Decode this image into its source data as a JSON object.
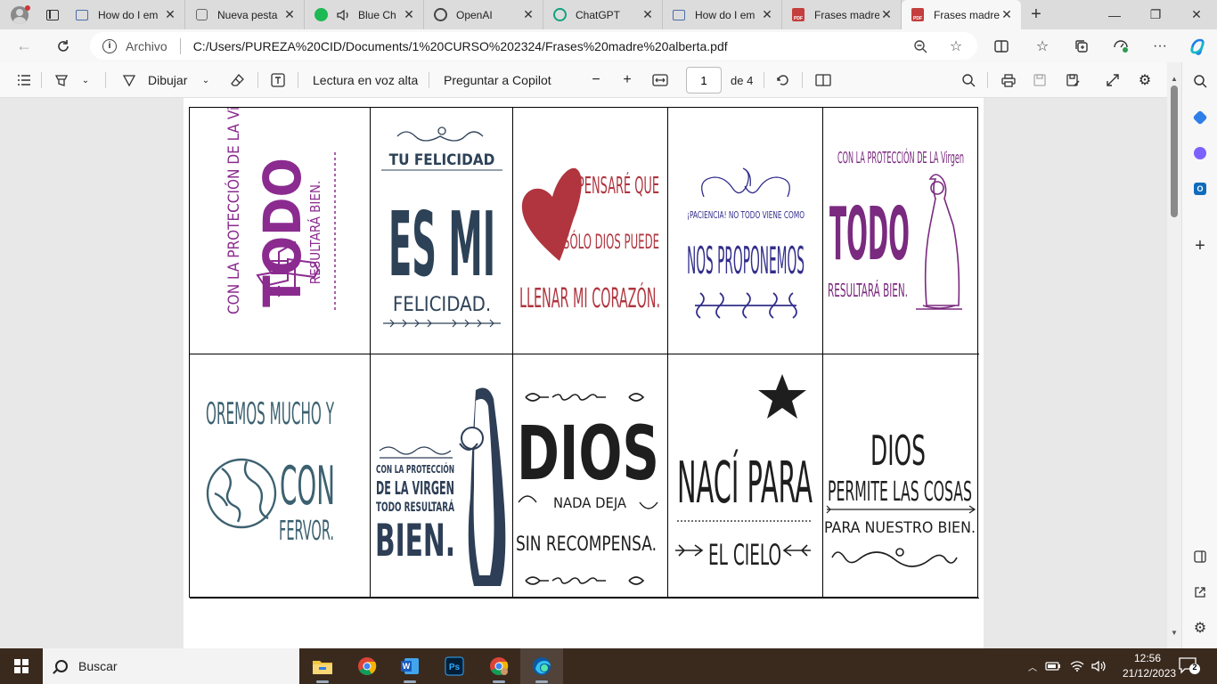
{
  "browser": {
    "tabs": [
      {
        "title": "How do I em",
        "icon": "window-icon"
      },
      {
        "title": "Nueva pesta",
        "icon": "blank-tab-icon"
      },
      {
        "title": "Blue Ch",
        "icon": "spotify-icon"
      },
      {
        "title": "OpenAI",
        "icon": "openai-icon"
      },
      {
        "title": "ChatGPT",
        "icon": "chatgpt-icon"
      },
      {
        "title": "How do I em",
        "icon": "window-icon"
      },
      {
        "title": "Frases madre",
        "icon": "pdf-icon"
      },
      {
        "title": "Frases madre",
        "icon": "pdf-icon",
        "active": true
      }
    ],
    "pdf_badge": "PDF",
    "address": {
      "site_label": "Archivo",
      "url": "C:/Users/PUREZA%20CID/Documents/1%20CURSO%202324/Frases%20madre%20alberta.pdf"
    }
  },
  "pdf_toolbar": {
    "draw_label": "Dibujar",
    "read_aloud_label": "Lectura en voz alta",
    "copilot_label": "Preguntar a Copilot",
    "page_number": "1",
    "page_total": "de 4"
  },
  "cards": {
    "c1": {
      "lines": [
        "CON LA PROTECCIÓN DE LA Virgen",
        "TODO",
        "RESULTARÁ BIEN."
      ],
      "color": "#8b2b8f"
    },
    "c2": {
      "lines": [
        "TU FELICIDAD",
        "ES MI",
        "FELICIDAD."
      ],
      "color": "#2d4257"
    },
    "c3": {
      "lines": [
        "PENSARÉ QUE",
        "SÓLO DIOS PUEDE",
        "LLENAR MI CORAZÓN."
      ],
      "color": "#b0353f"
    },
    "c4": {
      "lines": [
        "¡PACIENCIA! NO TODO VIENE COMO",
        "NOS PROPONEMOS"
      ],
      "color": "#322e8a"
    },
    "c5": {
      "lines": [
        "CON LA PROTECCIÓN DE LA Virgen",
        "TODO",
        "RESULTARÁ BIEN."
      ],
      "color": "#7a2a7f"
    },
    "c6": {
      "lines": [
        "OREMOS MUCHO Y",
        "CON",
        "FERVOR."
      ],
      "color": "#3c6170"
    },
    "c7": {
      "lines": [
        "CON LA PROTECCIÓN",
        "DE LA VIRGEN",
        "TODO RESULTARÁ",
        "BIEN."
      ],
      "color": "#2d3e56"
    },
    "c8": {
      "lines": [
        "DIOS",
        "NADA DEJA",
        "SIN RECOMPENSA."
      ],
      "color": "#1e1e1e"
    },
    "c9": {
      "lines": [
        "NACÍ PARA",
        "EL CIELO"
      ],
      "color": "#1e1e1e"
    },
    "c10": {
      "lines": [
        "DIOS",
        "PERMITE LAS COSAS",
        "PARA NUESTRO BIEN."
      ],
      "color": "#1e1e1e"
    }
  },
  "taskbar": {
    "search_label": "Buscar",
    "time": "12:56",
    "date": "21/12/2023",
    "notifications": "2"
  }
}
